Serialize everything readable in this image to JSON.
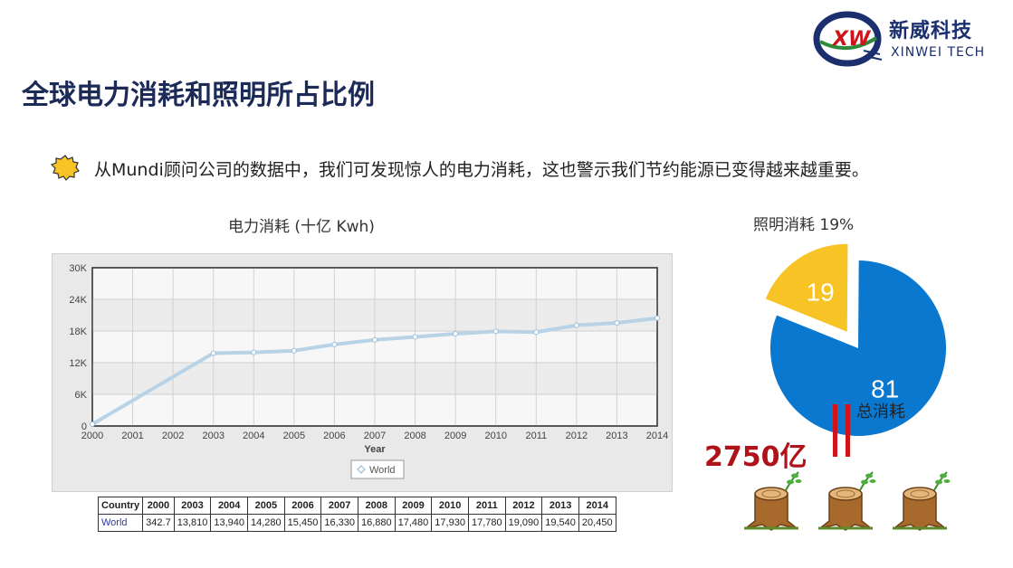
{
  "header": {
    "title": "全球电力消耗和照明所占比例",
    "logo": {
      "cn": "新威科技",
      "en": "XINWEI TECH",
      "mark_text": "XW",
      "colors": {
        "navy": "#1b2f6e",
        "red": "#d0151a",
        "green": "#2e8b3a"
      }
    }
  },
  "bullet": {
    "icon": "sun-burst-icon",
    "text": "从Mundi顾问公司的数据中，我们可发现惊人的电力消耗，这也警示我们节约能源已变得越来越重要。"
  },
  "line_chart": {
    "title": "电力消耗 (十亿 Kwh)",
    "legend_label": "World"
  },
  "table": {
    "country_header": "Country",
    "years": [
      "2000",
      "2003",
      "2004",
      "2005",
      "2006",
      "2007",
      "2008",
      "2009",
      "2010",
      "2011",
      "2012",
      "2013",
      "2014"
    ],
    "row_label": "World",
    "values": [
      "342.7",
      "13,810",
      "13,940",
      "14,280",
      "15,450",
      "16,330",
      "16,880",
      "17,480",
      "17,930",
      "17,780",
      "19,090",
      "19,540",
      "20,450"
    ]
  },
  "pie_chart": {
    "title": "照明消耗 19%",
    "big_label": "81",
    "small_label": "19"
  },
  "annotations": {
    "total_amount": "2750亿",
    "total_label": "总消耗"
  },
  "colors": {
    "pie_blue": "#0b78d0",
    "pie_yellow": "#f7c325",
    "line": "#b8d3e6",
    "amount_red": "#b0121a"
  },
  "chart_data": [
    {
      "type": "line",
      "title": "",
      "xlabel": "Year",
      "ylabel": "",
      "x": [
        2000,
        2003,
        2004,
        2005,
        2006,
        2007,
        2008,
        2009,
        2010,
        2011,
        2012,
        2013,
        2014
      ],
      "x_ticks": [
        "2000",
        "2001",
        "2002",
        "2003",
        "2004",
        "2005",
        "2006",
        "2007",
        "2008",
        "2009",
        "2010",
        "2011",
        "2012",
        "2013",
        "2014"
      ],
      "y_ticks": [
        "0",
        "6K",
        "12K",
        "18K",
        "24K",
        "30K"
      ],
      "ylim": [
        0,
        30000
      ],
      "xlim": [
        2000,
        2014
      ],
      "grid": true,
      "legend": "bottom-center",
      "series": [
        {
          "name": "World",
          "values": [
            342.7,
            13810,
            13940,
            14280,
            15450,
            16330,
            16880,
            17480,
            17930,
            17780,
            19090,
            19540,
            20450
          ]
        }
      ]
    },
    {
      "type": "pie",
      "title": "照明消耗 19%",
      "labels": [
        "19",
        "81"
      ],
      "values": [
        19,
        81
      ],
      "colors": [
        "#f7c325",
        "#0b78d0"
      ]
    }
  ]
}
